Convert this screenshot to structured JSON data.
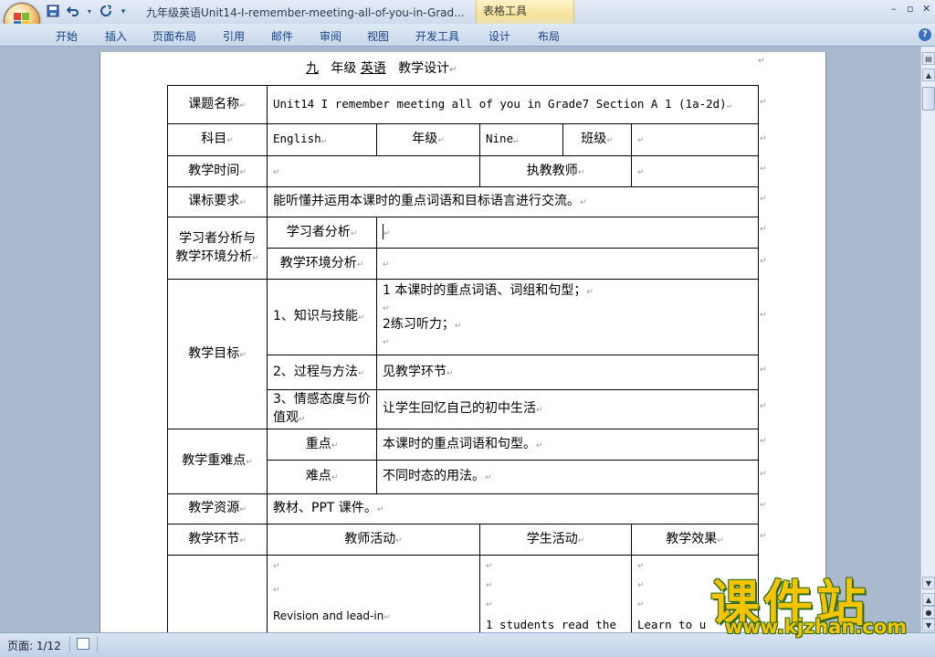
{
  "window": {
    "title": "九年级英语Unit14-I-remember-meeting-all-of-you-in-Grad...",
    "context_tab_group": "表格工具",
    "minimize": "–",
    "restore": "▫",
    "close": "✕"
  },
  "ribbon": {
    "tabs": [
      "开始",
      "插入",
      "页面布局",
      "引用",
      "邮件",
      "审阅",
      "视图",
      "开发工具",
      "设计",
      "布局"
    ]
  },
  "document": {
    "heading": {
      "grade": "九",
      "grade_suffix": "年级",
      "subject": "英语",
      "design": "教学设计"
    },
    "rows": {
      "topic_label": "课题名称",
      "topic_value": "Unit14 I remember meeting all of you in Grade7 Section A 1 (1a-2d)",
      "subject_label": "科目",
      "subject_value": "English",
      "grade_label": "年级",
      "grade_value": "Nine",
      "class_label": "班级",
      "time_label": "教学时间",
      "teacher_label": "执教教师",
      "standard_label": "课标要求",
      "standard_value": "能听懂并运用本课时的重点词语和目标语言进行交流。",
      "analysis_label": "学习者分析与教学环境分析",
      "learner_label": "学习者分析",
      "env_label": "教学环境分析",
      "goals_label": "教学目标",
      "knowledge_label": "1、知识与技能",
      "knowledge_line1": "1 本课时的重点词语、词组和句型；",
      "knowledge_line2": "2练习听力；",
      "process_label": "2、过程与方法",
      "process_value": "见教学环节",
      "emotion_label": "3、情感态度与价值观",
      "emotion_value": "让学生回忆自己的初中生活",
      "keypoints_label": "教学重难点",
      "key_label": "重点",
      "key_value": "本课时的重点词语和句型。",
      "difficult_label": "难点",
      "difficult_value": "不同时态的用法。",
      "resources_label": "教学资源",
      "resources_value": "教材、PPT 课件。",
      "steps_label": "教学环节",
      "teacher_activity": "教师活动",
      "student_activity": "学生活动",
      "effect_label": "教学效果",
      "revision": "Revision and lead-in",
      "student_text": "1 students read the",
      "effect_text": "Learn to u"
    }
  },
  "status": {
    "page": "页面: 1/12"
  },
  "watermark": {
    "brand": "课件站",
    "url": "www.kjzhan.com"
  }
}
